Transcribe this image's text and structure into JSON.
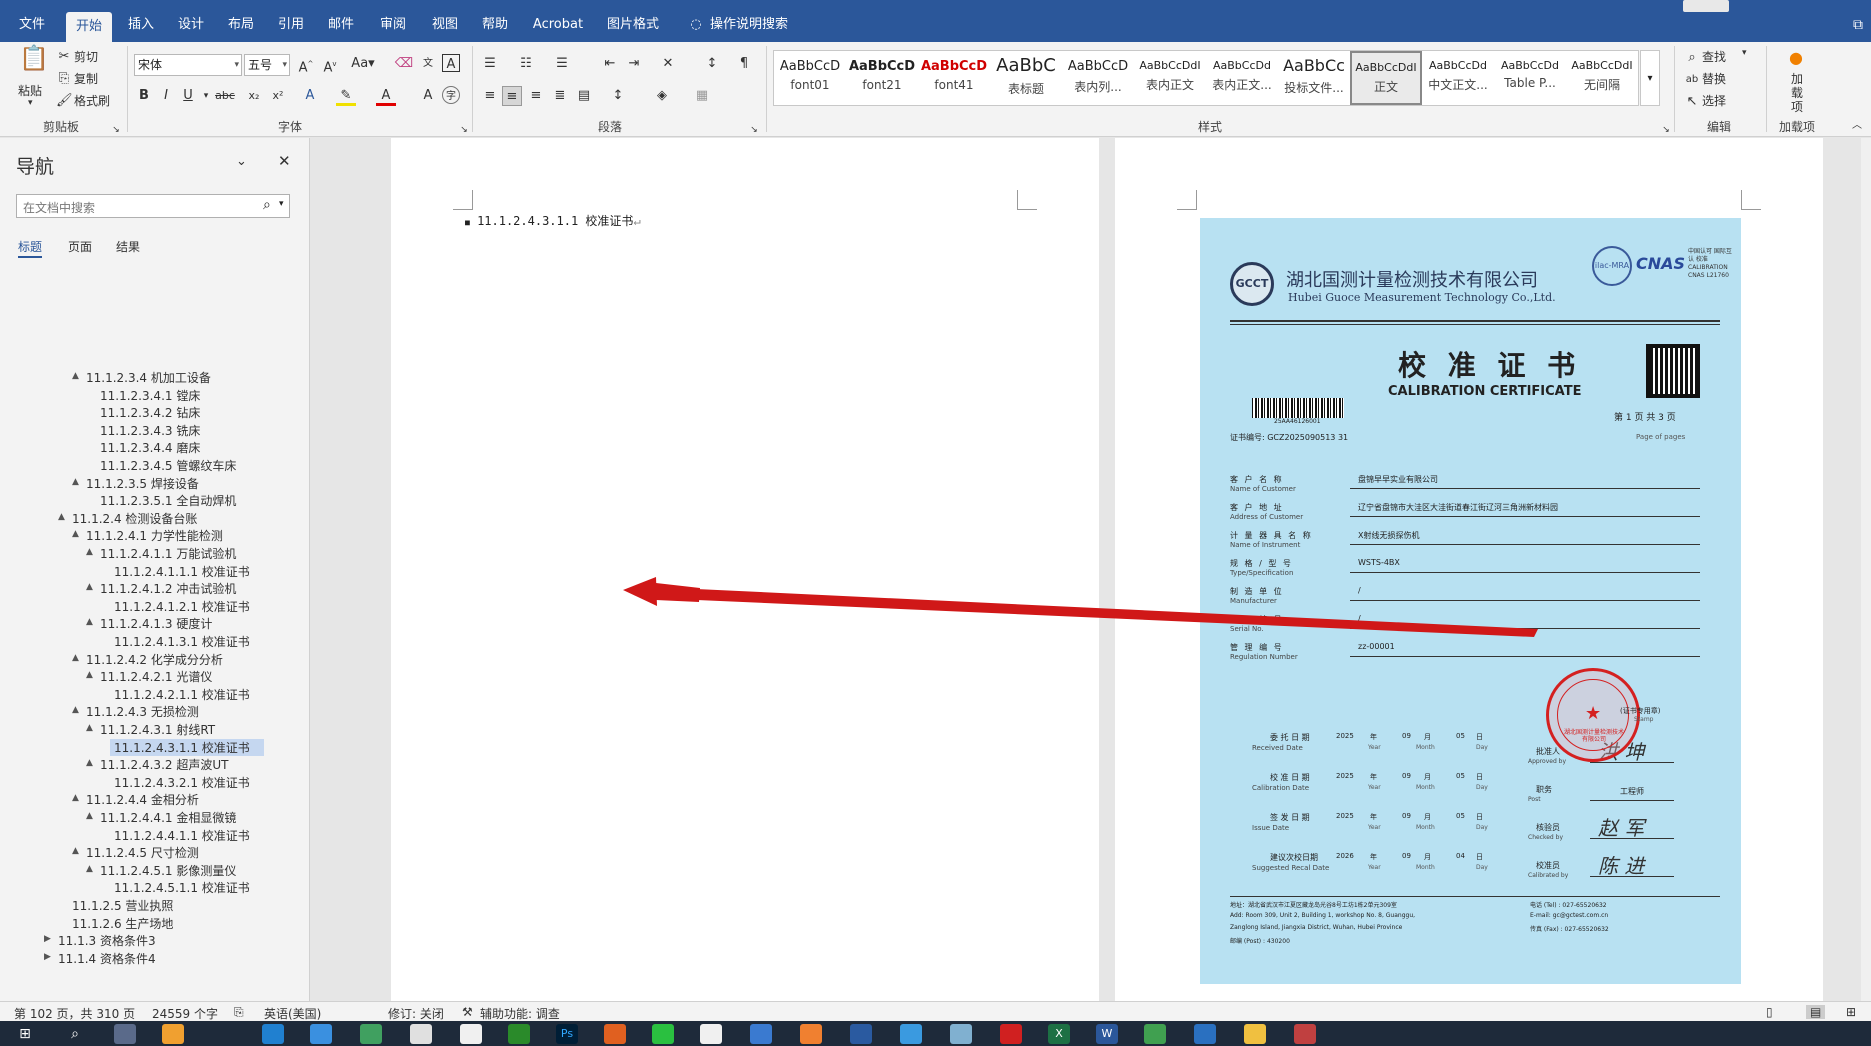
{
  "tabs": [
    {
      "label": "文件"
    },
    {
      "label": "开始"
    },
    {
      "label": "插入"
    },
    {
      "label": "设计"
    },
    {
      "label": "布局"
    },
    {
      "label": "引用"
    },
    {
      "label": "邮件"
    },
    {
      "label": "审阅"
    },
    {
      "label": "视图"
    },
    {
      "label": "帮助"
    },
    {
      "label": "Acrobat"
    },
    {
      "label": "图片格式"
    },
    {
      "label": "操作说明搜索"
    }
  ],
  "ribbon": {
    "paste": "粘贴",
    "cut": "剪切",
    "copy": "复制",
    "format_painter": "格式刷",
    "clipboard": "剪贴板",
    "font": "字体",
    "paragraph": "段落",
    "styles": "样式",
    "editing": "编辑",
    "addins": "加载项",
    "font_name": "宋体",
    "font_size": "五号",
    "find": "查找",
    "replace": "替换",
    "select": "选择",
    "addin_btn": "加载项"
  },
  "styles": [
    {
      "preview": "AaBbCcD",
      "name": "font01",
      "color": "#222"
    },
    {
      "preview": "AaBbCcD",
      "name": "font21",
      "color": "#222"
    },
    {
      "preview": "AaBbCcD",
      "name": "font41",
      "color": "#d00000"
    },
    {
      "preview": "AaBbC",
      "name": "表标题",
      "color": "#222"
    },
    {
      "preview": "AaBbCcD",
      "name": "表内列...",
      "color": "#222"
    },
    {
      "preview": "AaBbCcDdI",
      "name": "表内正文",
      "color": "#222"
    },
    {
      "preview": "AaBbCcDd",
      "name": "表内正文...",
      "color": "#222"
    },
    {
      "preview": "AaBbCc",
      "name": "投标文件...",
      "color": "#222"
    },
    {
      "preview": "AaBbCcDdI",
      "name": "正文",
      "color": "#222"
    },
    {
      "preview": "AaBbCcDd",
      "name": "中文正文...",
      "color": "#222"
    },
    {
      "preview": "AaBbCcDd",
      "name": "Table P...",
      "color": "#222"
    },
    {
      "preview": "AaBbCcDdI",
      "name": "无间隔",
      "color": "#222"
    }
  ],
  "nav": {
    "title": "导航",
    "search_placeholder": "在文档中搜索",
    "tabs": [
      "标题",
      "页面",
      "结果"
    ],
    "items": [
      {
        "text": "11.1.2.3.4 机加工设备",
        "expand": "▲"
      },
      {
        "text": "11.1.2.3.4.1 镗床",
        "expand": ""
      },
      {
        "text": "11.1.2.3.4.2 钻床",
        "expand": ""
      },
      {
        "text": "11.1.2.3.4.3 铣床",
        "expand": ""
      },
      {
        "text": "11.1.2.3.4.4 磨床",
        "expand": ""
      },
      {
        "text": "11.1.2.3.4.5 管螺纹车床",
        "expand": ""
      },
      {
        "text": "11.1.2.3.5 焊接设备",
        "expand": "▲"
      },
      {
        "text": "11.1.2.3.5.1 全自动焊机",
        "expand": ""
      },
      {
        "text": "11.1.2.4 检测设备台账",
        "expand": "▲"
      },
      {
        "text": "11.1.2.4.1 力学性能检测",
        "expand": "▲"
      },
      {
        "text": "11.1.2.4.1.1 万能试验机",
        "expand": "▲"
      },
      {
        "text": "11.1.2.4.1.1.1 校准证书",
        "expand": ""
      },
      {
        "text": "11.1.2.4.1.2 冲击试验机",
        "expand": "▲"
      },
      {
        "text": "11.1.2.4.1.2.1 校准证书",
        "expand": ""
      },
      {
        "text": "11.1.2.4.1.3 硬度计",
        "expand": "▲"
      },
      {
        "text": "11.1.2.4.1.3.1 校准证书",
        "expand": ""
      },
      {
        "text": "11.1.2.4.2 化学成分分析",
        "expand": "▲"
      },
      {
        "text": "11.1.2.4.2.1 光谱仪",
        "expand": "▲"
      },
      {
        "text": "11.1.2.4.2.1.1 校准证书",
        "expand": ""
      },
      {
        "text": "11.1.2.4.3 无损检测",
        "expand": "▲"
      },
      {
        "text": "11.1.2.4.3.1 射线RT",
        "expand": "▲"
      },
      {
        "text": "11.1.2.4.3.1.1 校准证书",
        "expand": ""
      },
      {
        "text": "11.1.2.4.3.2 超声波UT",
        "expand": "▲"
      },
      {
        "text": "11.1.2.4.3.2.1 校准证书",
        "expand": ""
      },
      {
        "text": "11.1.2.4.4 金相分析",
        "expand": "▲"
      },
      {
        "text": "11.1.2.4.4.1 金相显微镜",
        "expand": "▲"
      },
      {
        "text": "11.1.2.4.4.1.1 校准证书",
        "expand": ""
      },
      {
        "text": "11.1.2.4.5 尺寸检测",
        "expand": "▲"
      },
      {
        "text": "11.1.2.4.5.1 影像测量仪",
        "expand": "▲"
      },
      {
        "text": "11.1.2.4.5.1.1 校准证书",
        "expand": ""
      },
      {
        "text": "11.1.2.5 营业执照",
        "expand": ""
      },
      {
        "text": "11.1.2.6 生产场地",
        "expand": ""
      },
      {
        "text": "11.1.3 资格条件3",
        "expand": "▶"
      },
      {
        "text": "11.1.4 资格条件4",
        "expand": "▶"
      }
    ]
  },
  "doc": {
    "heading": "11.1.2.4.3.1.1 校准证书"
  },
  "cert": {
    "company_cn": "湖北国测计量检测技术有限公司",
    "company_en": "Hubei Guoce Measurement Technology Co.,Ltd.",
    "title_cn": "校 准 证 书",
    "title_en": "CALIBRATION CERTIFICATE",
    "barcode_no": "25AA46126001",
    "cert_no": "证书编号: GCZ2025090513 31",
    "page_info": "第 1 页 共 3 页",
    "page_en": "Page   of   pages",
    "fields": [
      {
        "cn": "客 户 名 称",
        "en": "Name of Customer",
        "value": "盘锦早早实业有限公司"
      },
      {
        "cn": "客 户 地 址",
        "en": "Address of Customer",
        "value": "辽宁省盘锦市大洼区大洼街道春江街辽河三角洲新材料园"
      },
      {
        "cn": "计 量 器 具 名 称",
        "en": "Name of Instrument",
        "value": "X射线无损探伤机"
      },
      {
        "cn": "规 格 / 型 号",
        "en": "Type/Specification",
        "value": "WSTS-4BX"
      },
      {
        "cn": "制 造 单 位",
        "en": "Manufacturer",
        "value": "/"
      },
      {
        "cn": "出 厂 编 号",
        "en": "Serial No.",
        "value": "/"
      },
      {
        "cn": "管 理 编 号",
        "en": "Regulation Number",
        "value": "zz-00001"
      }
    ],
    "dates": [
      {
        "cn": "委 托 日 期",
        "en": "Received Date",
        "y": "2025",
        "m": "09",
        "d": "05"
      },
      {
        "cn": "校 准 日 期",
        "en": "Calibration Date",
        "y": "2025",
        "m": "09",
        "d": "05"
      },
      {
        "cn": "签 发 日 期",
        "en": "Issue Date",
        "y": "2025",
        "m": "09",
        "d": "05"
      },
      {
        "cn": "建议次校日期",
        "en": "Suggested Recal Date",
        "y": "2026",
        "m": "09",
        "d": "04"
      }
    ],
    "ymd": {
      "y": "年",
      "m": "月",
      "d": "日",
      "ye": "Year",
      "me": "Month",
      "de": "Day"
    },
    "roles": [
      {
        "cn": "批准人",
        "en": "Approved by",
        "sig": "洪 坤"
      },
      {
        "cn": "职务",
        "en": "Post",
        "sig": "工程师"
      },
      {
        "cn": "核验员",
        "en": "Checked by",
        "sig": "赵 军"
      },
      {
        "cn": "校准员",
        "en": "Calibrated by",
        "sig": "陈 进"
      }
    ],
    "stamp_note": "(证书专用章)",
    "stamp_en": "Stamp",
    "footer_left": [
      "地址：湖北省武汉市江夏区藏龙岛光谷8号工坊1栋2单元309室",
      "Add: Room 309, Unit 2, Building 1, workshop No. 8, Guanggu,",
      "Zanglong Island, Jiangxia District, Wuhan, Hubei Province",
      "邮编 (Post) : 430200"
    ],
    "footer_right": [
      "电话 (Tel) : 027-65520632",
      "E-mail: gc@gctest.com.cn",
      "传真 (Fax) : 027-65520632"
    ],
    "seal_text": "湖北国测计量检测技术有限公司",
    "cnas": "CNAS",
    "cnas_sub": "中国认可 国际互认 校准 CALIBRATION CNAS L21760"
  },
  "status": {
    "page": "第 102 页，共 310 页",
    "words": "24559 个字",
    "lang": "英语(美国)",
    "track": "修订: 关闭",
    "access": "辅助功能: 调查"
  },
  "colors": {
    "word_blue": "#2b579a",
    "cert_bg": "#b8e1f2",
    "arrow": "#d01818",
    "seal": "#d42020"
  }
}
